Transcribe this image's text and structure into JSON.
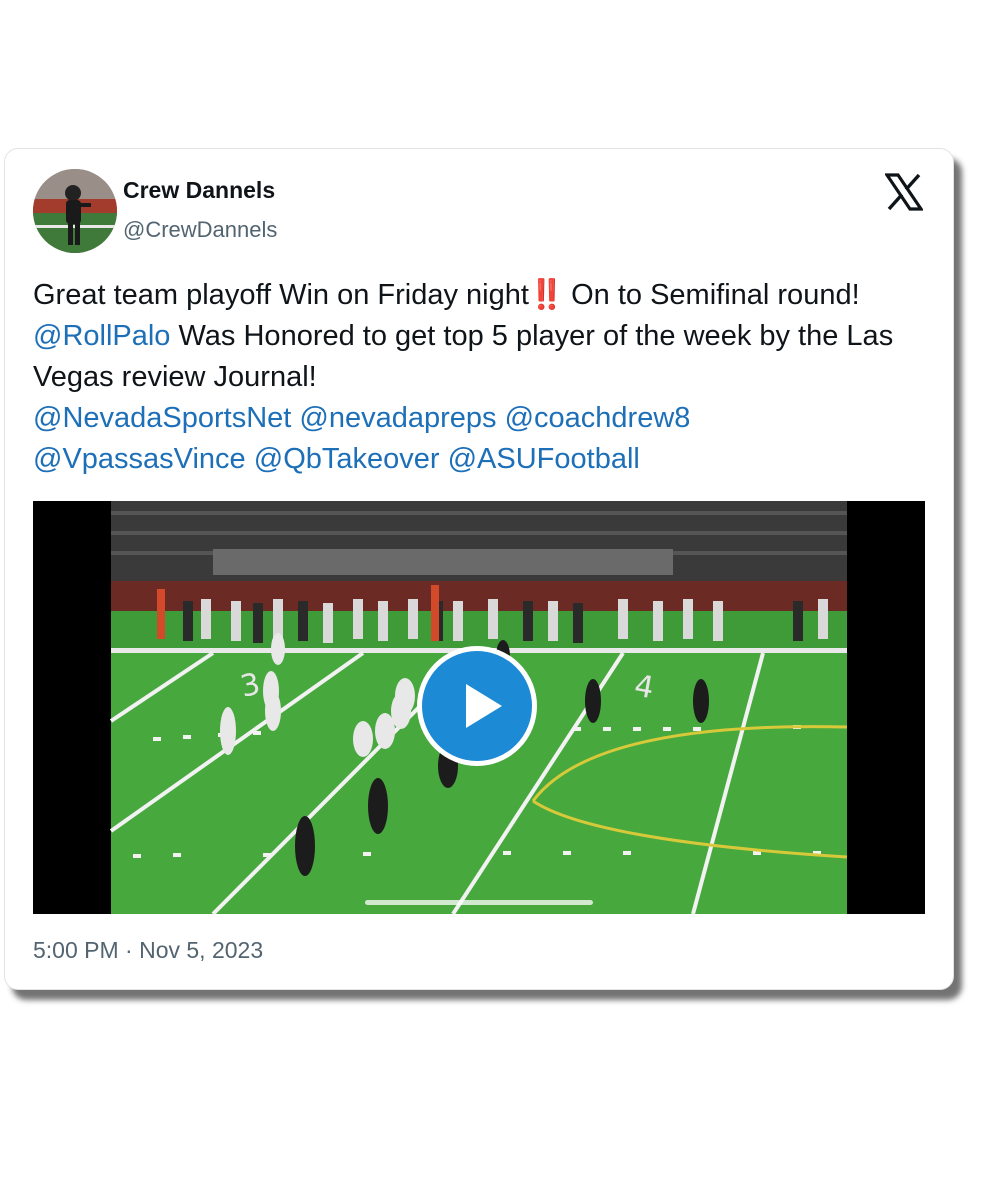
{
  "author": {
    "display_name": "Crew Dannels",
    "handle": "@CrewDannels",
    "avatar_icon": "avatar-photo-football-player"
  },
  "brand": {
    "logo_icon": "x-logo-icon"
  },
  "tweet": {
    "text_1": "Great team playoff Win on Friday night",
    "emoji": "‼️",
    "text_2": " On to Semifinal round! ",
    "mention_1": "@RollPalo",
    "text_3": "  Was Honored to get top 5 player of the week by the Las Vegas review Journal!",
    "mentions": [
      "@NevadaSportsNet",
      "@nevadapreps",
      "@coachdrew8",
      "@VpassasVince",
      "@QbTakeover",
      "@ASUFootball"
    ]
  },
  "media": {
    "type": "video",
    "play_icon": "play-icon",
    "field_markers": [
      "3",
      "4"
    ]
  },
  "timestamp": "5:00 PM · Nov 5, 2023",
  "colors": {
    "link": "#1d6fb8",
    "play_button": "#1d8ad6",
    "emoji": "#e0202a"
  }
}
